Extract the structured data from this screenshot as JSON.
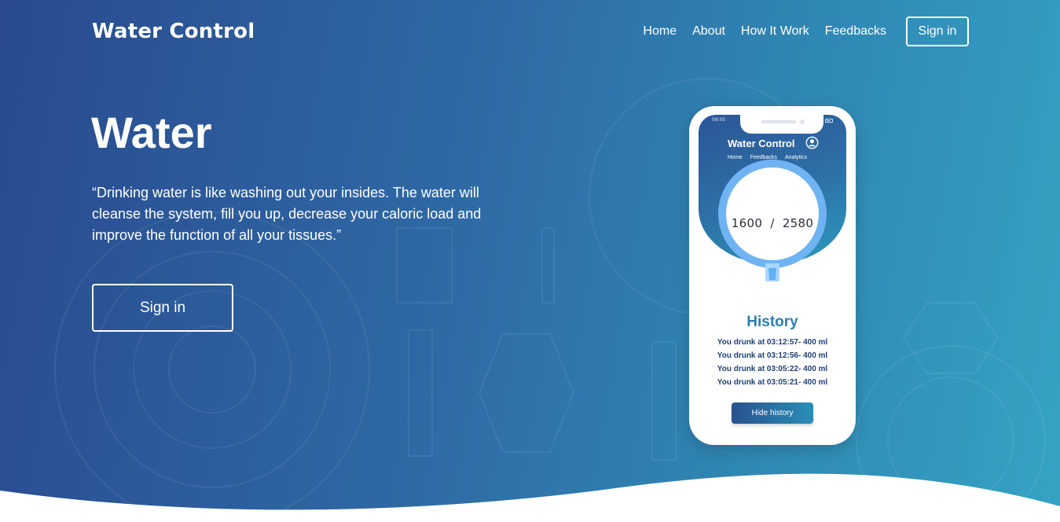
{
  "header": {
    "brand": "Water Control",
    "nav": [
      "Home",
      "About",
      "How It Work",
      "Feedbacks"
    ],
    "signin_label": "Sign in"
  },
  "hero": {
    "title": "Water",
    "quote": "“Drinking water is like washing out your insides. The water will cleanse the system, fill you up, decrease your caloric load and improve the function of all your tissues.”",
    "button_label": "Sign in"
  },
  "phone": {
    "status_time": "09:05",
    "app_title": "Water Control",
    "app_nav": [
      "Home",
      "Feedbacks",
      "Analytics"
    ],
    "consumed": "1600",
    "separator": "/",
    "goal": "2580",
    "progress_fraction": 0.62,
    "history_title": "History",
    "history": [
      "You drunk at 03:12:57- 400 ml",
      "You drunk at 03:12:56- 400 ml",
      "You drunk at 03:05:22- 400 ml",
      "You drunk at 03:05:21- 400 ml"
    ],
    "hide_button": "Hide history"
  },
  "colors": {
    "gradient_start": "#294a8f",
    "gradient_end": "#35a3c4",
    "ring": "#6fb3f2",
    "history_title": "#2d7fb6"
  },
  "icons": {
    "user": "user-circle-icon",
    "glass": "water-glass-icon"
  }
}
